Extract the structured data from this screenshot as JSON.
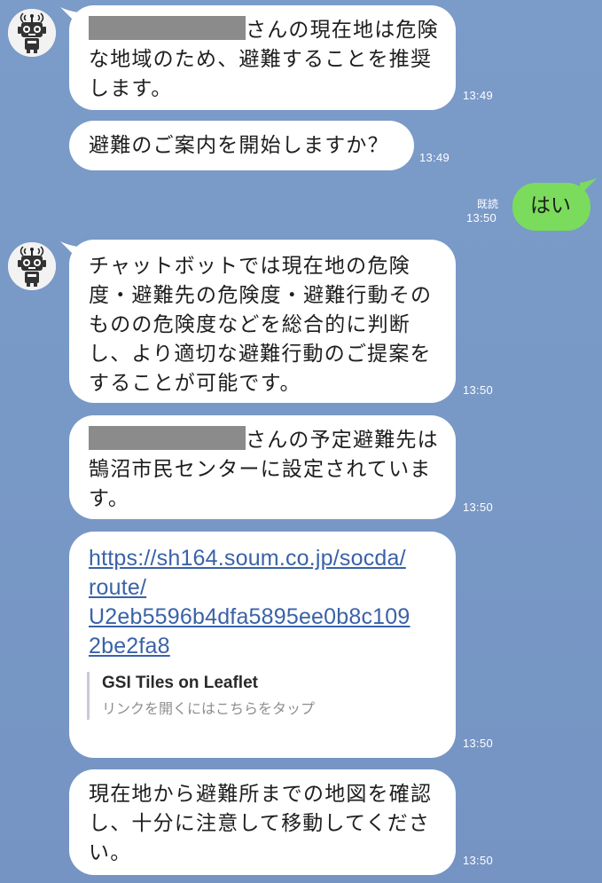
{
  "avatar_icon": "robot-bot-icon",
  "colors": {
    "background": "#7898c6",
    "bubble": "#ffffff",
    "sent_bubble": "#7bdb5c",
    "link": "#3a62a8"
  },
  "messages": [
    {
      "lines": [
        "さんの現在地は危険",
        "な地域のため、避難することを推奨",
        "します。"
      ],
      "time": "13:49"
    },
    {
      "lines": [
        "避難のご案内を開始しますか？"
      ],
      "time": "13:49"
    },
    {
      "text": "はい",
      "read": "既読",
      "time": "13:50"
    },
    {
      "lines": [
        "チャットボットでは現在地の危険",
        "度・避難先の危険度・避難行動その",
        "ものの危険度などを総合的に判断",
        "し、より適切な避難行動のご提案を",
        "することが可能です。"
      ],
      "time": "13:50"
    },
    {
      "lines": [
        "さんの予定避難先は",
        "鵠沼市民センターに設定されていま",
        "す。"
      ],
      "time": "13:50"
    },
    {
      "link_lines": [
        "https://sh164.soum.co.jp/socda/",
        "route/",
        "U2eb5596b4dfa5895ee0b8c109",
        "2be2fa8"
      ],
      "preview_title": "GSI Tiles on Leaflet",
      "preview_sub": "リンクを開くにはこちらをタップ",
      "time": "13:50"
    },
    {
      "lines": [
        "現在地から避難所までの地図を確認",
        "し、十分に注意して移動してくださ",
        "い。"
      ],
      "time": "13:50"
    }
  ]
}
